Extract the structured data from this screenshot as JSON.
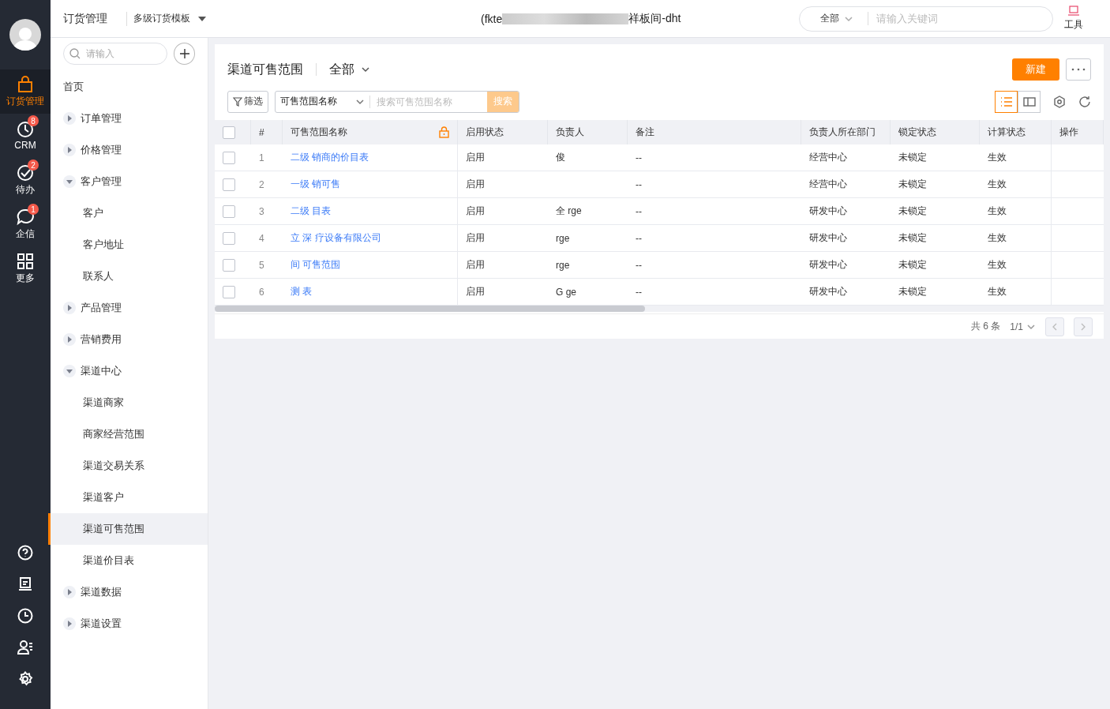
{
  "rail": {
    "items": [
      {
        "label": "订货管理",
        "selected": true
      },
      {
        "label": "CRM",
        "badge": "8",
        "selected": false
      },
      {
        "label": "待办",
        "badge": "2",
        "selected": false
      },
      {
        "label": "企信",
        "badge": "1",
        "selected": false
      },
      {
        "label": "更多",
        "selected": false
      }
    ]
  },
  "header": {
    "app": "订货管理",
    "template": "多级订货模板",
    "title_start": "(fkte",
    "title_end": "祥板间-dht",
    "scope": "全部",
    "search_placeholder": "请输入关键词",
    "tool": "工具"
  },
  "nav": {
    "search_placeholder": "请输入",
    "items": [
      {
        "label": "首页",
        "kind": "link",
        "selected": false
      },
      {
        "label": "订单管理",
        "kind": "group",
        "expanded": false
      },
      {
        "label": "价格管理",
        "kind": "group",
        "expanded": false
      },
      {
        "label": "客户管理",
        "kind": "group",
        "expanded": true,
        "children": [
          {
            "label": "客户",
            "selected": false
          },
          {
            "label": "客户地址",
            "selected": false
          },
          {
            "label": "联系人",
            "selected": false
          }
        ]
      },
      {
        "label": "产品管理",
        "kind": "group",
        "expanded": false
      },
      {
        "label": "营销费用",
        "kind": "group",
        "expanded": false
      },
      {
        "label": "渠道中心",
        "kind": "group",
        "expanded": true,
        "children": [
          {
            "label": "渠道商家",
            "selected": false
          },
          {
            "label": "商家经营范围",
            "selected": false
          },
          {
            "label": "渠道交易关系",
            "selected": false
          },
          {
            "label": "渠道客户",
            "selected": false
          },
          {
            "label": "渠道可售范围",
            "selected": true
          },
          {
            "label": "渠道价目表",
            "selected": false
          }
        ]
      },
      {
        "label": "渠道数据",
        "kind": "group",
        "expanded": false
      },
      {
        "label": "渠道设置",
        "kind": "group",
        "expanded": false
      }
    ]
  },
  "page": {
    "title": "渠道可售范围",
    "view": "全部",
    "new_button": "新建",
    "filter_button": "筛选",
    "field": "可售范围名称",
    "search_placeholder": "搜索可售范围名称",
    "search_button": "搜索",
    "view_modes": [
      {
        "selected": true
      },
      {
        "selected": false
      }
    ]
  },
  "table": {
    "select_all_checked": false,
    "columns": [
      "#",
      "可售范围名称",
      "启用状态",
      "负责人",
      "备注",
      "负责人所在部门",
      "锁定状态",
      "计算状态",
      "操作"
    ],
    "rows": [
      {
        "checked": false,
        "no": "1",
        "name": "二级 销商的价目表",
        "status": "启用",
        "owner": "俊",
        "remark": "--",
        "dept": "经营中心",
        "lock": "未锁定",
        "calc": "生效"
      },
      {
        "checked": false,
        "no": "2",
        "name": "一级 销可售",
        "status": "启用",
        "remark": "--",
        "dept": "经营中心",
        "lock": "未锁定",
        "calc": "生效"
      },
      {
        "checked": false,
        "no": "3",
        "name": "二级 目表",
        "status": "启用",
        "owner": "全 rge",
        "remark": "--",
        "dept": "研发中心",
        "lock": "未锁定",
        "calc": "生效"
      },
      {
        "checked": false,
        "no": "4",
        "name": "立 深 疗设备有限公司",
        "status": "启用",
        "owner": "rge",
        "remark": "--",
        "dept": "研发中心",
        "lock": "未锁定",
        "calc": "生效"
      },
      {
        "checked": false,
        "no": "5",
        "name": "间 可售范围",
        "status": "启用",
        "owner": "rge",
        "remark": "--",
        "dept": "研发中心",
        "lock": "未锁定",
        "calc": "生效"
      },
      {
        "checked": false,
        "no": "6",
        "name": "测 表",
        "status": "启用",
        "owner": "G ge",
        "remark": "--",
        "dept": "研发中心",
        "lock": "未锁定",
        "calc": "生效"
      }
    ]
  },
  "pager": {
    "total": "共 6 条",
    "page": "1/1"
  }
}
